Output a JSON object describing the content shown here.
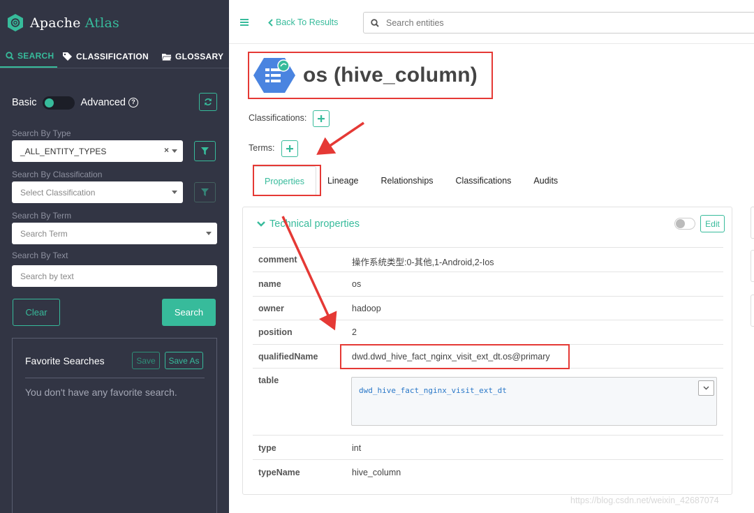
{
  "app": {
    "name_part1": "Apache",
    "name_part2": "Atlas"
  },
  "sidebar": {
    "tabs": [
      {
        "label": "SEARCH",
        "icon": "search-icon"
      },
      {
        "label": "CLASSIFICATION",
        "icon": "tag-icon"
      },
      {
        "label": "GLOSSARY",
        "icon": "folder-icon"
      }
    ],
    "mode_basic": "Basic",
    "mode_advanced": "Advanced",
    "help_glyph": "?",
    "type_label": "Search By Type",
    "type_value": "_ALL_ENTITY_TYPES",
    "type_clear": "×",
    "classification_label": "Search By Classification",
    "classification_placeholder": "Select Classification",
    "term_label": "Search By Term",
    "term_placeholder": "Search Term",
    "text_label": "Search By Text",
    "text_placeholder": "Search by text",
    "clear_button": "Clear",
    "search_button": "Search",
    "favorites": {
      "title": "Favorite Searches",
      "save": "Save",
      "save_as": "Save As",
      "empty": "You don't have any favorite search."
    }
  },
  "topbar": {
    "back_label": "Back To Results",
    "search_placeholder": "Search entities"
  },
  "entity": {
    "title": "os (hive_column)",
    "classifications_label": "Classifications:",
    "terms_label": "Terms:"
  },
  "detail_tabs": [
    "Properties",
    "Lineage",
    "Relationships",
    "Classifications",
    "Audits"
  ],
  "properties": {
    "title": "Technical properties",
    "edit": "Edit",
    "rows": [
      {
        "key": "comment",
        "value": "操作系统类型:0-其他,1-Android,2-Ios"
      },
      {
        "key": "name",
        "value": "os"
      },
      {
        "key": "owner",
        "value": "hadoop"
      },
      {
        "key": "position",
        "value": "2"
      },
      {
        "key": "qualifiedName",
        "value": "dwd.dwd_hive_fact_nginx_visit_ext_dt.os@primary"
      },
      {
        "key": "table",
        "value": "dwd_hive_fact_nginx_visit_ext_dt"
      },
      {
        "key": "type",
        "value": "int"
      },
      {
        "key": "typeName",
        "value": "hive_column"
      }
    ]
  },
  "watermark": "https://blog.csdn.net/weixin_42687074",
  "colors": {
    "accent": "#37bb9b",
    "sidebar_bg": "#323544",
    "annotation": "#e53935"
  }
}
